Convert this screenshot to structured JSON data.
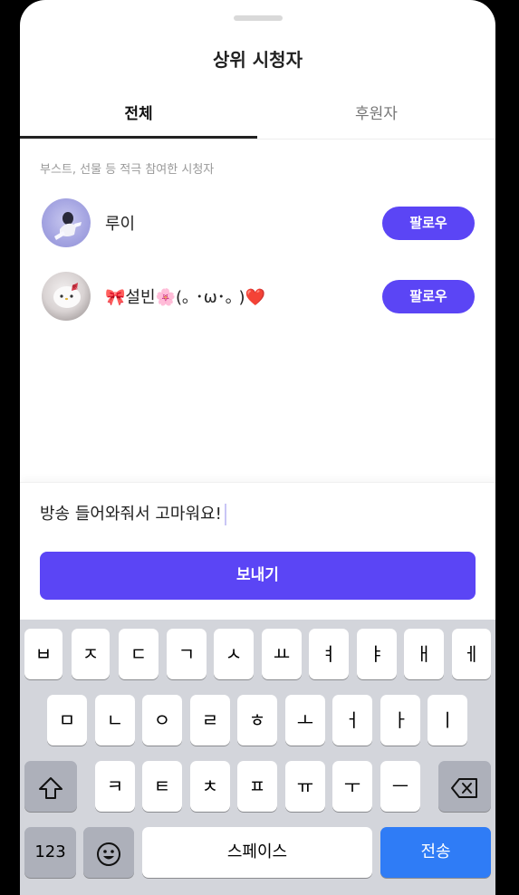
{
  "sheet": {
    "title": "상위 시청자",
    "tabs": [
      {
        "label": "전체",
        "active": true
      },
      {
        "label": "후원자",
        "active": false
      }
    ],
    "subtitle": "부스트, 선물 등 적극 참여한 시청자",
    "viewers": [
      {
        "name": "루이",
        "follow_label": "팔로우"
      },
      {
        "name": "🎀설빈🌸(｡ ･ω･｡ )❤️",
        "follow_label": "팔로우"
      }
    ]
  },
  "composer": {
    "message_value": "방송 들어와줘서 고마워요!",
    "send_label": "보내기"
  },
  "keyboard": {
    "row1": [
      "ㅂ",
      "ㅈ",
      "ㄷ",
      "ㄱ",
      "ㅅ",
      "ㅛ",
      "ㅕ",
      "ㅑ",
      "ㅐ",
      "ㅔ"
    ],
    "row2": [
      "ㅁ",
      "ㄴ",
      "ㅇ",
      "ㄹ",
      "ㅎ",
      "ㅗ",
      "ㅓ",
      "ㅏ",
      "ㅣ"
    ],
    "row3": [
      "ㅋ",
      "ㅌ",
      "ㅊ",
      "ㅍ",
      "ㅠ",
      "ㅜ",
      "ㅡ"
    ],
    "numbers_label": "123",
    "space_label": "스페이스",
    "return_label": "전송"
  },
  "colors": {
    "accent": "#5b45f5",
    "return_key": "#2f7cf6"
  }
}
